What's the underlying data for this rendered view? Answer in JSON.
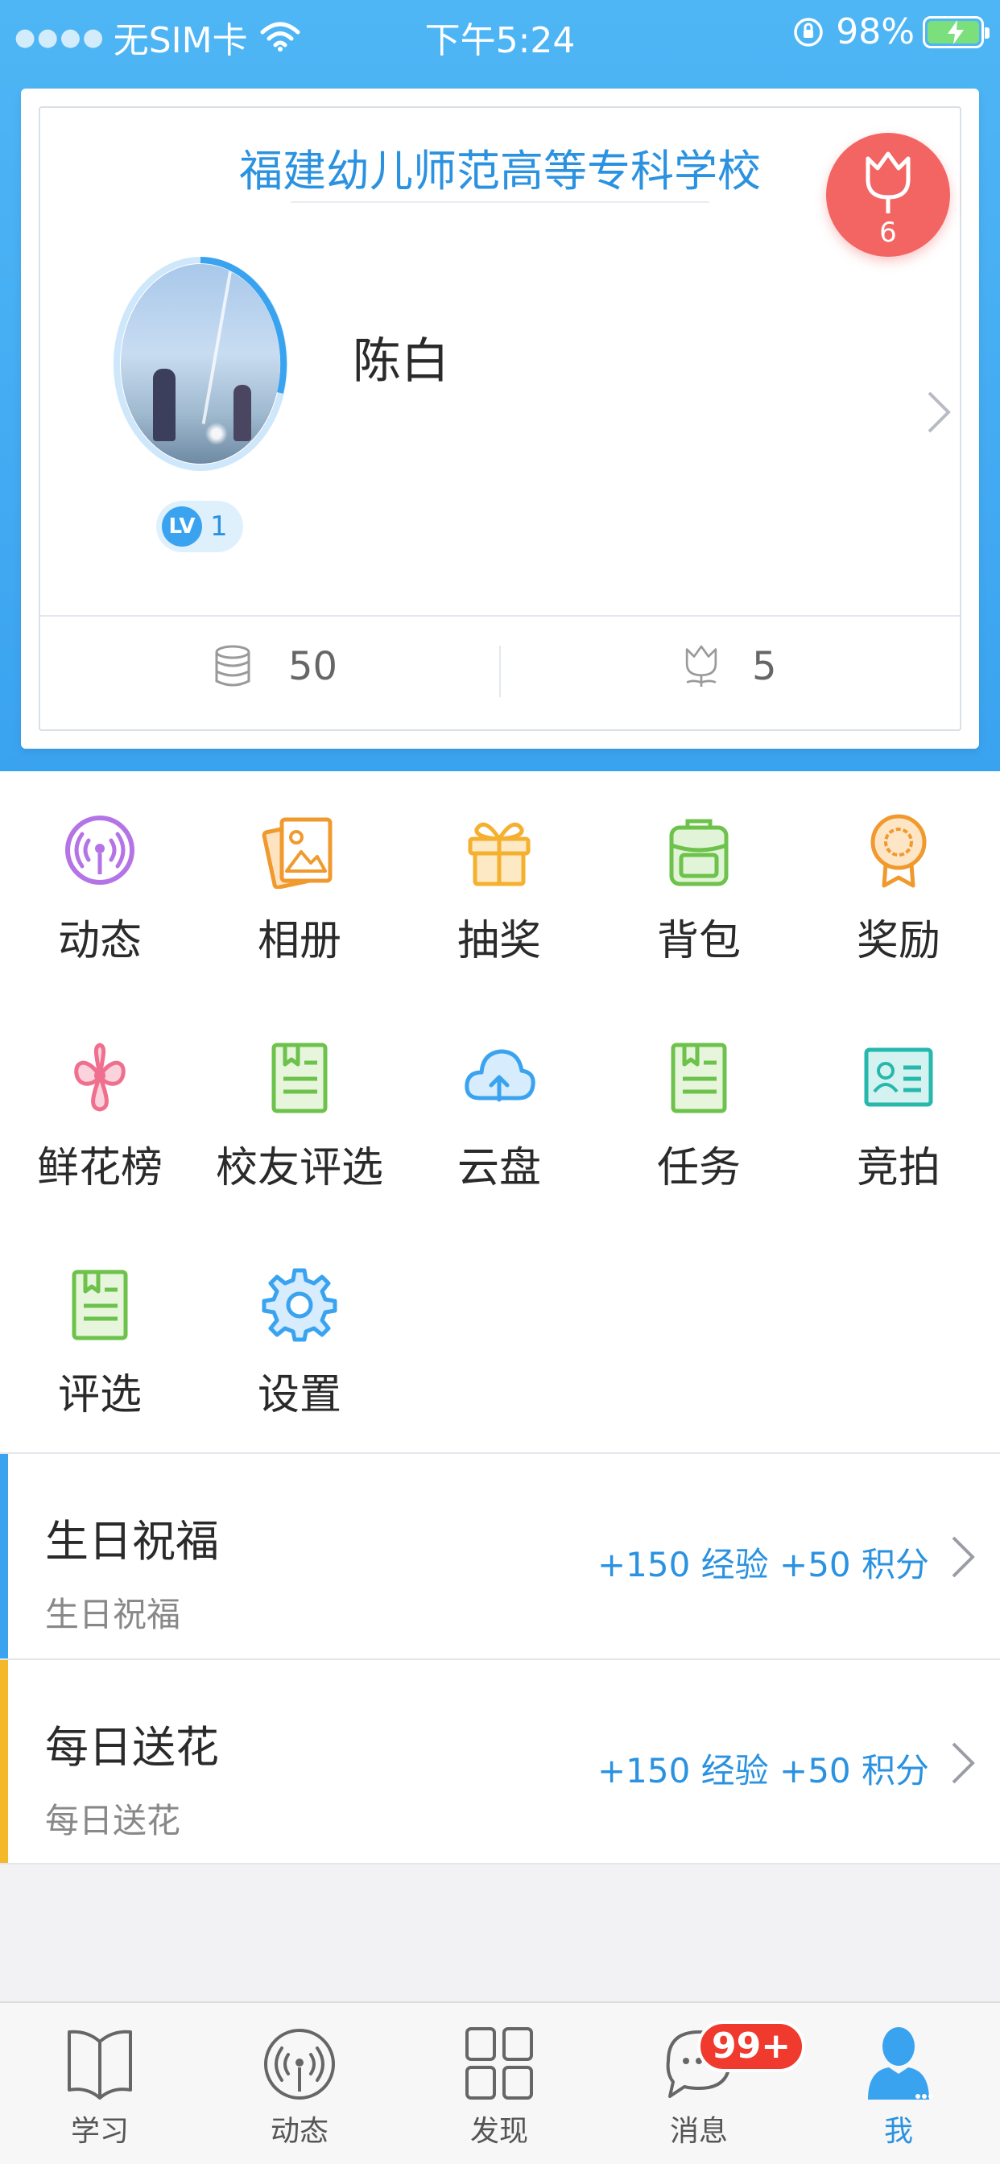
{
  "status_bar": {
    "carrier": "无SIM卡",
    "time": "下午5:24",
    "battery": "98%"
  },
  "profile": {
    "school": "福建幼儿师范高等专科学校",
    "name": "陈白",
    "level_badge": "LV",
    "level": "1",
    "flowers_received": "6",
    "coins": "50",
    "flowers": "5"
  },
  "grid": [
    {
      "label": "动态",
      "icon": "broadcast-icon"
    },
    {
      "label": "相册",
      "icon": "album-icon"
    },
    {
      "label": "抽奖",
      "icon": "gift-icon"
    },
    {
      "label": "背包",
      "icon": "backpack-icon"
    },
    {
      "label": "奖励",
      "icon": "medal-icon"
    },
    {
      "label": "鲜花榜",
      "icon": "flower-icon"
    },
    {
      "label": "校友评选",
      "icon": "document-icon"
    },
    {
      "label": "云盘",
      "icon": "cloud-upload-icon"
    },
    {
      "label": "任务",
      "icon": "document-icon"
    },
    {
      "label": "竞拍",
      "icon": "id-card-icon"
    },
    {
      "label": "评选",
      "icon": "document-icon"
    },
    {
      "label": "设置",
      "icon": "gear-icon"
    }
  ],
  "tasks": [
    {
      "title": "生日祝福",
      "subtitle": "生日祝福",
      "reward": "+150 经验 +50 积分",
      "accent": "#3aa3f0"
    },
    {
      "title": "每日送花",
      "subtitle": "每日送花",
      "reward": "+150 经验 +50 积分",
      "accent": "#f5b82a"
    }
  ],
  "tabbar": {
    "items": [
      {
        "label": "学习",
        "icon": "book-icon"
      },
      {
        "label": "动态",
        "icon": "broadcast-icon"
      },
      {
        "label": "发现",
        "icon": "grid-icon"
      },
      {
        "label": "消息",
        "icon": "chat-icon"
      },
      {
        "label": "我",
        "icon": "person-icon"
      }
    ],
    "message_badge": "99+",
    "active": "我"
  },
  "colors": {
    "primary": "#3aa3f0",
    "flower_badge": "#f26563",
    "message_badge": "#f03a2e"
  }
}
